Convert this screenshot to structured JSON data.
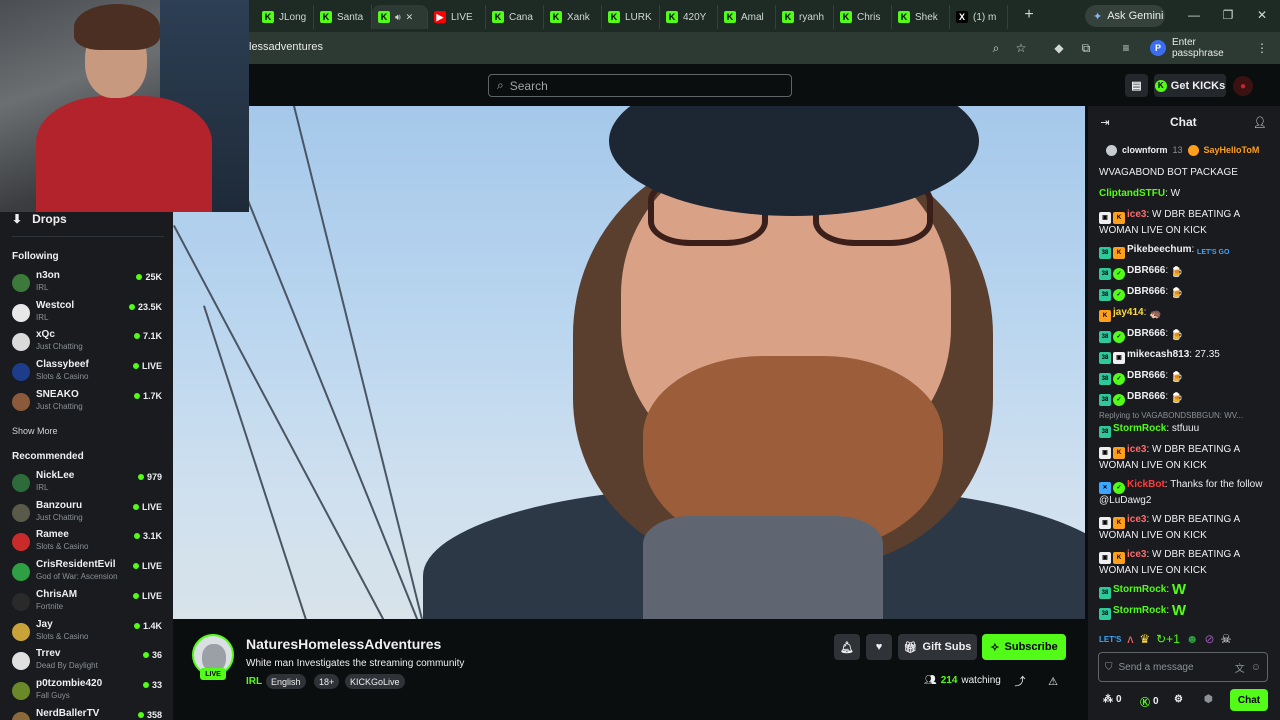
{
  "browser": {
    "tabs": [
      {
        "label": "JLong",
        "fav": "K",
        "kind": "kick"
      },
      {
        "label": "Santa",
        "fav": "K",
        "kind": "kick"
      },
      {
        "label": "",
        "fav": "K",
        "kind": "kick",
        "active": true
      },
      {
        "label": "LIVE",
        "fav": "▶",
        "kind": "youtube"
      },
      {
        "label": "Cana",
        "fav": "K",
        "kind": "kick"
      },
      {
        "label": "Xank",
        "fav": "K",
        "kind": "kick"
      },
      {
        "label": "LURK",
        "fav": "K",
        "kind": "kick"
      },
      {
        "label": "420Y",
        "fav": "K",
        "kind": "kick"
      },
      {
        "label": "Amal",
        "fav": "K",
        "kind": "kick"
      },
      {
        "label": "ryanh",
        "fav": "K",
        "kind": "kick"
      },
      {
        "label": "Chris",
        "fav": "K",
        "kind": "kick"
      },
      {
        "label": "Shek",
        "fav": "K",
        "kind": "kick"
      },
      {
        "label": "(1) m",
        "fav": "X",
        "kind": "x"
      }
    ],
    "ask_gemini": "Ask Gemini",
    "url": "lessadventures",
    "passphrase_label": "Enter passphrase",
    "passphrase_initial": "P"
  },
  "header": {
    "search_placeholder": "Search",
    "get_kicks_label": "Get KICKs"
  },
  "sidebar": {
    "drops_label": "Drops",
    "following_heading": "Following",
    "following": [
      {
        "name": "n3on",
        "category": "IRL",
        "viewers": "25K",
        "color": "#3b7a3b"
      },
      {
        "name": "Westcol",
        "category": "IRL",
        "viewers": "23.5K",
        "color": "#e8e8e8"
      },
      {
        "name": "xQc",
        "category": "Just Chatting",
        "viewers": "7.1K",
        "color": "#dadada"
      },
      {
        "name": "Classybeef",
        "category": "Slots & Casino",
        "viewers": "LIVE",
        "color": "#1d3c8a"
      },
      {
        "name": "SNEAKO",
        "category": "Just Chatting",
        "viewers": "1.7K",
        "color": "#8a5a3a"
      }
    ],
    "show_more": "Show More",
    "recommended_heading": "Recommended",
    "recommended": [
      {
        "name": "NickLee",
        "category": "IRL",
        "viewers": "979",
        "color": "#2e6b3a"
      },
      {
        "name": "Banzouru",
        "category": "Just Chatting",
        "viewers": "LIVE",
        "color": "#5a5a4a"
      },
      {
        "name": "Ramee",
        "category": "Slots & Casino",
        "viewers": "3.1K",
        "color": "#c92a2a"
      },
      {
        "name": "CrisResidentEvil",
        "category": "God of War: Ascension",
        "viewers": "LIVE",
        "color": "#2ea043"
      },
      {
        "name": "ChrisAM",
        "category": "Fortnite",
        "viewers": "LIVE",
        "color": "#2a2a2a"
      },
      {
        "name": "Jay",
        "category": "Slots & Casino",
        "viewers": "1.4K",
        "color": "#c9a23a"
      },
      {
        "name": "Trrev",
        "category": "Dead By Daylight",
        "viewers": "36",
        "color": "#e0e0e0"
      },
      {
        "name": "p0tzombie420",
        "category": "Fall Guys",
        "viewers": "33",
        "color": "#6a8a2a"
      },
      {
        "name": "NerdBallerTV",
        "category": "",
        "viewers": "358",
        "color": "#8a6a3a"
      }
    ]
  },
  "stream": {
    "channel_name": "NaturesHomelessAdventures",
    "title": "White man Investigates the streaming community",
    "category": "IRL",
    "tags": [
      "English",
      "18+",
      "KICKGoLive"
    ],
    "live_badge": "LIVE",
    "gift_subs_label": "Gift Subs",
    "subscribe_label": "Subscribe",
    "watching_count": "214",
    "watching_label": "watching"
  },
  "chat": {
    "title": "Chat",
    "pinned": [
      {
        "user": "clownform",
        "count": "13",
        "color": "#efeff1"
      },
      {
        "user": "SayHelloToM",
        "color": "#ff9f1c"
      }
    ],
    "partial_top": "WVAGABOND BOT PACKAGE",
    "messages": [
      {
        "user": "CliptandSTFU",
        "color": "#53fc18",
        "text": "W",
        "badges": []
      },
      {
        "user": "ice3",
        "color": "#ff6b6b",
        "text": "W DBR BEATING A WOMAN LIVE ON KICK",
        "badges": [
          "box",
          "k"
        ]
      },
      {
        "user": "Pikebeechum",
        "color": "#efeff1",
        "text": "",
        "badges": [
          "sub",
          "k"
        ],
        "emote": "LET'S GO"
      },
      {
        "user": "DBR666",
        "color": "#efeff1",
        "text": "",
        "badges": [
          "sub",
          "ver"
        ],
        "emote": "🍺"
      },
      {
        "user": "DBR666",
        "color": "#efeff1",
        "text": "",
        "badges": [
          "sub",
          "ver"
        ],
        "emote": "🍺"
      },
      {
        "user": "jay414",
        "color": "#ffd93d",
        "text": "",
        "badges": [
          "k"
        ],
        "emote": "🦔"
      },
      {
        "user": "DBR666",
        "color": "#efeff1",
        "text": "",
        "badges": [
          "sub",
          "ver"
        ],
        "emote": "🍺"
      },
      {
        "user": "mikecash813",
        "color": "#efeff1",
        "text": "27.35",
        "badges": [
          "sub",
          "box"
        ]
      },
      {
        "user": "DBR666",
        "color": "#efeff1",
        "text": "",
        "badges": [
          "sub",
          "ver"
        ],
        "emote": "🍺"
      },
      {
        "user": "DBR666",
        "color": "#efeff1",
        "text": "",
        "badges": [
          "sub",
          "ver"
        ],
        "emote": "🍺"
      }
    ],
    "reply_to": "Replying to VAGABONDSBBGUN: WV...",
    "messages2": [
      {
        "user": "StormRock",
        "color": "#53fc18",
        "text": "stfuuu",
        "badges": [
          "sub"
        ]
      },
      {
        "user": "ice3",
        "color": "#ff6b6b",
        "text": "W DBR BEATING A WOMAN LIVE ON KICK",
        "badges": [
          "box",
          "k"
        ]
      },
      {
        "user": "KickBot",
        "color": "#ff3b3b",
        "text": "Thanks for the follow @LuDawg2",
        "badges": [
          "mod",
          "ver"
        ]
      },
      {
        "user": "ice3",
        "color": "#ff6b6b",
        "text": "W DBR BEATING A WOMAN LIVE ON KICK",
        "badges": [
          "box",
          "k"
        ]
      },
      {
        "user": "ice3",
        "color": "#ff6b6b",
        "text": "W DBR BEATING A WOMAN LIVE ON KICK",
        "badges": [
          "box",
          "k"
        ]
      },
      {
        "user": "StormRock",
        "color": "#53fc18",
        "text": "",
        "badges": [
          "sub"
        ],
        "emote": "W"
      },
      {
        "user": "StormRock",
        "color": "#53fc18",
        "text": "",
        "badges": [
          "sub"
        ],
        "emote": "W"
      }
    ],
    "input_placeholder": "Send a message",
    "footer_points": "0",
    "footer_kicks": "0",
    "send_label": "Chat"
  }
}
